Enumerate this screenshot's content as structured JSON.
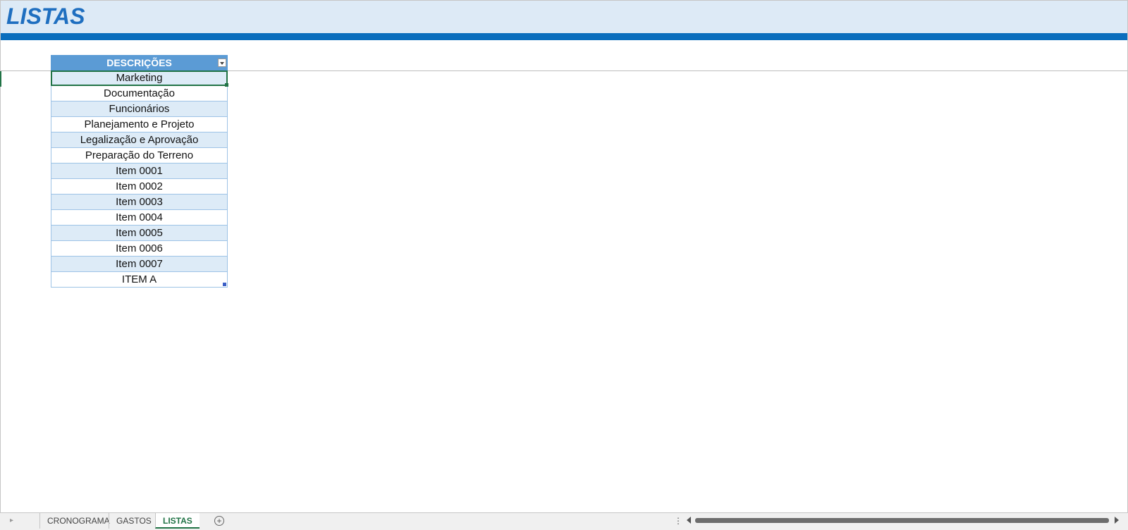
{
  "sheet": {
    "title": "LISTAS"
  },
  "table": {
    "header": "DESCRIÇÕES",
    "rows": [
      "Marketing",
      "Documentação",
      "Funcionários",
      "Planejamento e Projeto",
      "Legalização e Aprovação",
      "Preparação do Terreno",
      "Item 0001",
      "Item 0002",
      "Item 0003",
      "Item 0004",
      "Item 0005",
      "Item 0006",
      "Item 0007",
      "ITEM A"
    ]
  },
  "tabs": {
    "items": [
      "CRONOGRAMA",
      "GASTOS",
      "LISTAS"
    ],
    "active": "LISTAS",
    "add_label": "+"
  },
  "colors": {
    "title_text": "#1f6fc0",
    "title_band": "#ddeaf6",
    "title_rule": "#0a6ebd",
    "header_bg": "#5b9bd5",
    "band_row": "#ddebf7",
    "accent": "#217346"
  },
  "icons": {
    "filter": "filter-dropdown-icon",
    "add_sheet": "plus-circle-icon",
    "scroll_left": "triangle-left-icon",
    "scroll_right": "triangle-right-icon"
  }
}
